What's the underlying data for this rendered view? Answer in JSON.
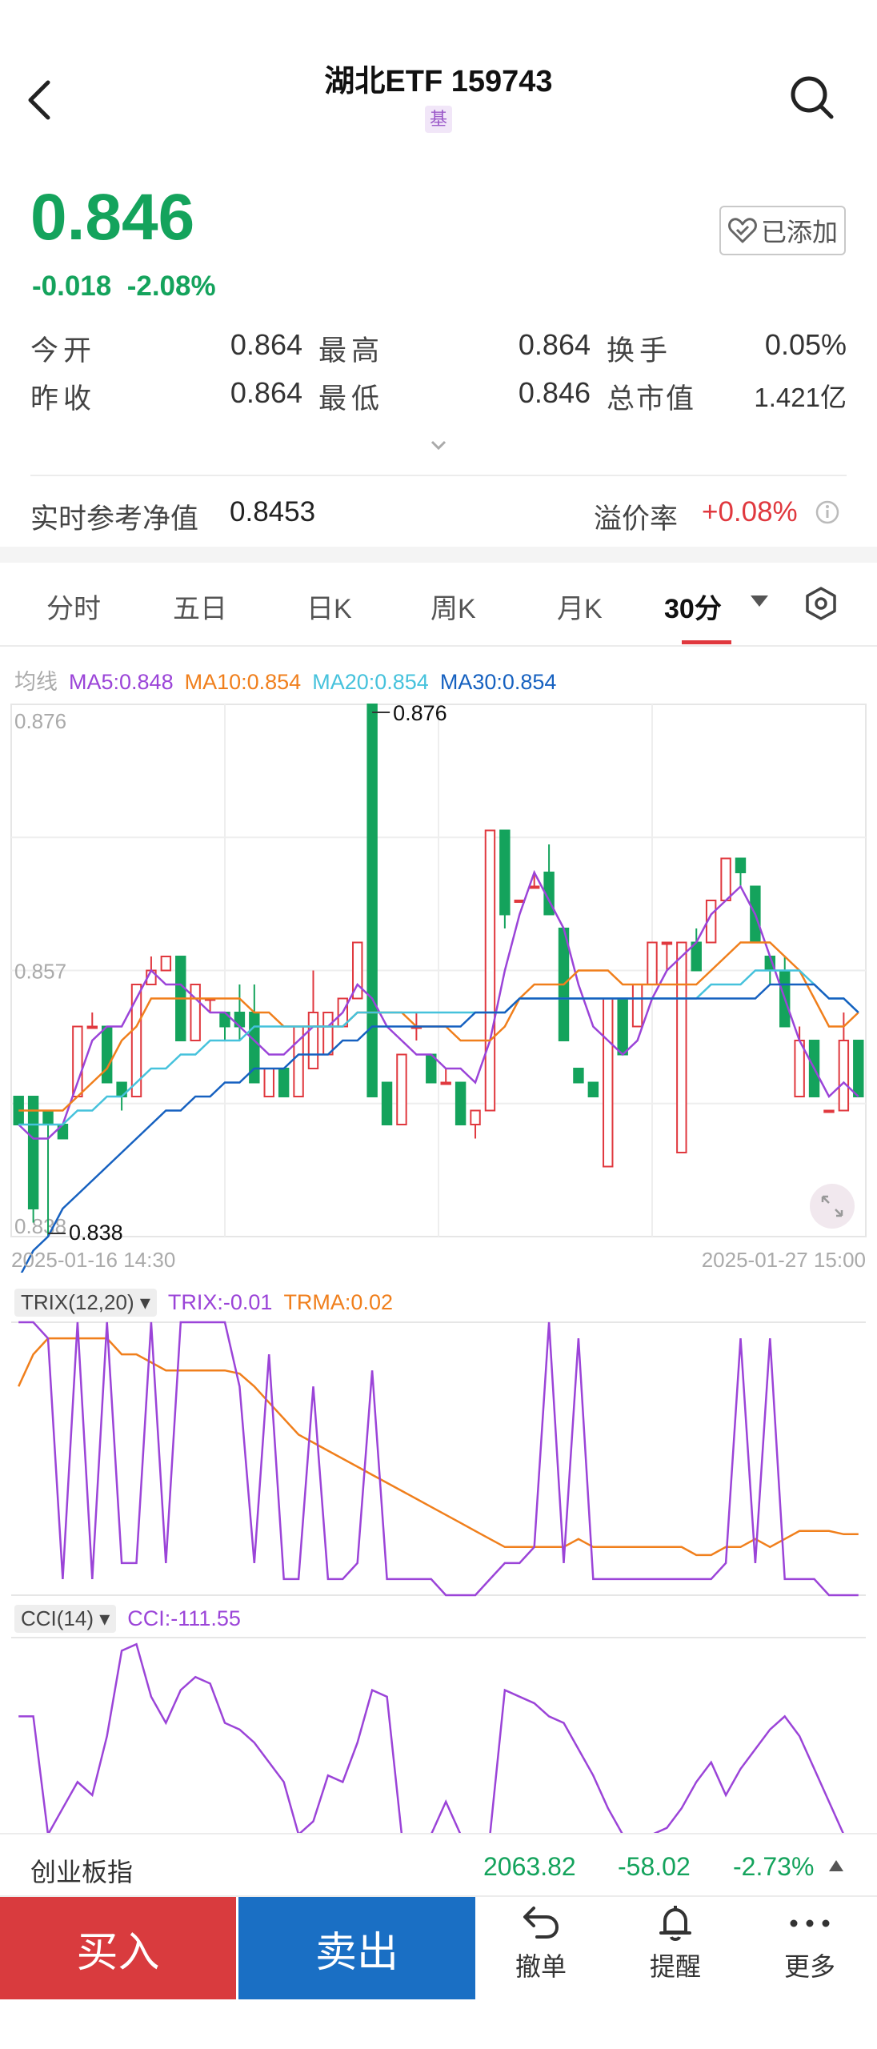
{
  "header": {
    "title": "湖北ETF 159743",
    "badge": "基"
  },
  "quote": {
    "price": "0.846",
    "change": "-0.018",
    "change_pct": "-2.08%",
    "added_label": "已添加"
  },
  "stats": [
    {
      "label": "今开",
      "value": "0.864",
      "color": "#333333"
    },
    {
      "label": "最高",
      "value": "0.864",
      "color": "#333333"
    },
    {
      "label": "换手",
      "value": "0.05%",
      "color": "#333333"
    },
    {
      "label": "昨收",
      "value": "0.864",
      "color": "#333333"
    },
    {
      "label": "最低",
      "value": "0.846",
      "color": "#14a35c"
    },
    {
      "label": "总市值",
      "value": "1.421亿",
      "color": "#333333"
    }
  ],
  "nav": {
    "label": "实时参考净值",
    "value": "0.8453",
    "premium_label": "溢价率",
    "premium_value": "+0.08%"
  },
  "tabs": [
    "分时",
    "五日",
    "日K",
    "周K",
    "月K",
    "30分"
  ],
  "active_tab": "30分",
  "legend": {
    "title": "均线",
    "ma5": "MA5:0.848",
    "ma10": "MA10:0.854",
    "ma20": "MA20:0.854",
    "ma30": "MA30:0.854"
  },
  "colors": {
    "up": "#e0383e",
    "down": "#14a35c",
    "ma5": "#9b44d8",
    "ma10": "#f07f1c",
    "ma20": "#46c2dc",
    "ma30": "#1661c0",
    "trix": "#9b44d8",
    "trma": "#f07f1c",
    "cci": "#9b44d8"
  },
  "chart_data": [
    {
      "type": "candlestick",
      "y_ticks": [
        "0.876",
        "0.857",
        "0.838"
      ],
      "ylim": [
        0.838,
        0.876
      ],
      "max_label": "0.876",
      "min_label": "0.838",
      "x_start": "2025-01-16 14:30",
      "x_end": "2025-01-27 15:00",
      "candles": [
        {
          "o": 0.848,
          "c": 0.846,
          "h": 0.848,
          "l": 0.846
        },
        {
          "o": 0.848,
          "c": 0.84,
          "h": 0.848,
          "l": 0.839
        },
        {
          "o": 0.847,
          "c": 0.846,
          "h": 0.847,
          "l": 0.838
        },
        {
          "o": 0.846,
          "c": 0.845,
          "h": 0.846,
          "l": 0.845
        },
        {
          "o": 0.848,
          "c": 0.853,
          "h": 0.853,
          "l": 0.848
        },
        {
          "o": 0.853,
          "c": 0.853,
          "h": 0.854,
          "l": 0.853
        },
        {
          "o": 0.853,
          "c": 0.849,
          "h": 0.853,
          "l": 0.849
        },
        {
          "o": 0.849,
          "c": 0.848,
          "h": 0.849,
          "l": 0.847
        },
        {
          "o": 0.848,
          "c": 0.856,
          "h": 0.856,
          "l": 0.848
        },
        {
          "o": 0.856,
          "c": 0.857,
          "h": 0.858,
          "l": 0.856
        },
        {
          "o": 0.857,
          "c": 0.858,
          "h": 0.858,
          "l": 0.857
        },
        {
          "o": 0.858,
          "c": 0.852,
          "h": 0.858,
          "l": 0.852
        },
        {
          "o": 0.852,
          "c": 0.856,
          "h": 0.856,
          "l": 0.852
        },
        {
          "o": 0.855,
          "c": 0.855,
          "h": 0.855,
          "l": 0.854
        },
        {
          "o": 0.854,
          "c": 0.853,
          "h": 0.854,
          "l": 0.852
        },
        {
          "o": 0.854,
          "c": 0.853,
          "h": 0.856,
          "l": 0.852
        },
        {
          "o": 0.854,
          "c": 0.849,
          "h": 0.856,
          "l": 0.849
        },
        {
          "o": 0.848,
          "c": 0.85,
          "h": 0.85,
          "l": 0.848
        },
        {
          "o": 0.85,
          "c": 0.848,
          "h": 0.85,
          "l": 0.848
        },
        {
          "o": 0.848,
          "c": 0.853,
          "h": 0.853,
          "l": 0.848
        },
        {
          "o": 0.85,
          "c": 0.854,
          "h": 0.857,
          "l": 0.85
        },
        {
          "o": 0.851,
          "c": 0.854,
          "h": 0.854,
          "l": 0.851
        },
        {
          "o": 0.853,
          "c": 0.855,
          "h": 0.855,
          "l": 0.853
        },
        {
          "o": 0.855,
          "c": 0.859,
          "h": 0.859,
          "l": 0.855
        },
        {
          "o": 0.876,
          "c": 0.848,
          "h": 0.876,
          "l": 0.848
        },
        {
          "o": 0.849,
          "c": 0.846,
          "h": 0.849,
          "l": 0.846
        },
        {
          "o": 0.846,
          "c": 0.851,
          "h": 0.851,
          "l": 0.846
        },
        {
          "o": 0.853,
          "c": 0.853,
          "h": 0.854,
          "l": 0.852
        },
        {
          "o": 0.851,
          "c": 0.849,
          "h": 0.851,
          "l": 0.849
        },
        {
          "o": 0.849,
          "c": 0.849,
          "h": 0.85,
          "l": 0.849
        },
        {
          "o": 0.849,
          "c": 0.846,
          "h": 0.849,
          "l": 0.846
        },
        {
          "o": 0.846,
          "c": 0.847,
          "h": 0.847,
          "l": 0.845
        },
        {
          "o": 0.847,
          "c": 0.867,
          "h": 0.867,
          "l": 0.847
        },
        {
          "o": 0.867,
          "c": 0.861,
          "h": 0.867,
          "l": 0.86
        },
        {
          "o": 0.862,
          "c": 0.862,
          "h": 0.862,
          "l": 0.862
        },
        {
          "o": 0.863,
          "c": 0.863,
          "h": 0.864,
          "l": 0.863
        },
        {
          "o": 0.864,
          "c": 0.861,
          "h": 0.866,
          "l": 0.861
        },
        {
          "o": 0.86,
          "c": 0.852,
          "h": 0.86,
          "l": 0.852
        },
        {
          "o": 0.85,
          "c": 0.849,
          "h": 0.85,
          "l": 0.849
        },
        {
          "o": 0.849,
          "c": 0.848,
          "h": 0.849,
          "l": 0.848
        },
        {
          "o": 0.843,
          "c": 0.855,
          "h": 0.855,
          "l": 0.843
        },
        {
          "o": 0.855,
          "c": 0.851,
          "h": 0.855,
          "l": 0.851
        },
        {
          "o": 0.853,
          "c": 0.856,
          "h": 0.856,
          "l": 0.853
        },
        {
          "o": 0.856,
          "c": 0.859,
          "h": 0.859,
          "l": 0.856
        },
        {
          "o": 0.859,
          "c": 0.859,
          "h": 0.859,
          "l": 0.857
        },
        {
          "o": 0.844,
          "c": 0.859,
          "h": 0.859,
          "l": 0.844
        },
        {
          "o": 0.859,
          "c": 0.857,
          "h": 0.86,
          "l": 0.857
        },
        {
          "o": 0.859,
          "c": 0.862,
          "h": 0.862,
          "l": 0.859
        },
        {
          "o": 0.862,
          "c": 0.865,
          "h": 0.865,
          "l": 0.862
        },
        {
          "o": 0.865,
          "c": 0.864,
          "h": 0.865,
          "l": 0.863
        },
        {
          "o": 0.863,
          "c": 0.859,
          "h": 0.863,
          "l": 0.859
        },
        {
          "o": 0.858,
          "c": 0.857,
          "h": 0.858,
          "l": 0.856
        },
        {
          "o": 0.857,
          "c": 0.853,
          "h": 0.858,
          "l": 0.853
        },
        {
          "o": 0.848,
          "c": 0.852,
          "h": 0.853,
          "l": 0.848
        },
        {
          "o": 0.852,
          "c": 0.848,
          "h": 0.852,
          "l": 0.848
        },
        {
          "o": 0.847,
          "c": 0.847,
          "h": 0.847,
          "l": 0.847
        },
        {
          "o": 0.847,
          "c": 0.852,
          "h": 0.854,
          "l": 0.847
        },
        {
          "o": 0.852,
          "c": 0.848,
          "h": 0.852,
          "l": 0.848
        }
      ],
      "ma5": [
        0.846,
        0.845,
        0.845,
        0.846,
        0.849,
        0.852,
        0.853,
        0.853,
        0.855,
        0.857,
        0.856,
        0.856,
        0.855,
        0.854,
        0.854,
        0.853,
        0.852,
        0.851,
        0.851,
        0.852,
        0.853,
        0.853,
        0.854,
        0.856,
        0.855,
        0.853,
        0.852,
        0.851,
        0.851,
        0.85,
        0.85,
        0.849,
        0.852,
        0.857,
        0.861,
        0.864,
        0.862,
        0.86,
        0.856,
        0.853,
        0.852,
        0.851,
        0.852,
        0.855,
        0.857,
        0.858,
        0.859,
        0.861,
        0.862,
        0.863,
        0.861,
        0.858,
        0.855,
        0.852,
        0.85,
        0.848,
        0.849,
        0.848
      ],
      "ma10": [
        0.847,
        0.847,
        0.847,
        0.847,
        0.848,
        0.849,
        0.85,
        0.852,
        0.853,
        0.855,
        0.855,
        0.855,
        0.855,
        0.855,
        0.855,
        0.855,
        0.854,
        0.854,
        0.853,
        0.853,
        0.853,
        0.853,
        0.853,
        0.854,
        0.854,
        0.854,
        0.854,
        0.853,
        0.853,
        0.853,
        0.852,
        0.852,
        0.852,
        0.853,
        0.855,
        0.856,
        0.856,
        0.856,
        0.857,
        0.857,
        0.857,
        0.856,
        0.856,
        0.856,
        0.856,
        0.856,
        0.856,
        0.857,
        0.858,
        0.859,
        0.859,
        0.859,
        0.858,
        0.857,
        0.855,
        0.853,
        0.853,
        0.854
      ],
      "ma20": [
        0.846,
        0.846,
        0.846,
        0.846,
        0.847,
        0.847,
        0.848,
        0.848,
        0.849,
        0.85,
        0.85,
        0.851,
        0.851,
        0.852,
        0.852,
        0.852,
        0.853,
        0.853,
        0.853,
        0.853,
        0.853,
        0.853,
        0.853,
        0.854,
        0.854,
        0.854,
        0.854,
        0.854,
        0.854,
        0.854,
        0.854,
        0.854,
        0.854,
        0.854,
        0.855,
        0.855,
        0.855,
        0.855,
        0.855,
        0.855,
        0.855,
        0.855,
        0.855,
        0.855,
        0.855,
        0.855,
        0.855,
        0.856,
        0.856,
        0.856,
        0.857,
        0.857,
        0.857,
        0.857,
        0.856,
        0.855,
        0.855,
        0.854
      ],
      "ma30": [
        0.835,
        0.837,
        0.838,
        0.84,
        0.841,
        0.842,
        0.843,
        0.844,
        0.845,
        0.846,
        0.847,
        0.847,
        0.848,
        0.848,
        0.849,
        0.849,
        0.85,
        0.85,
        0.85,
        0.851,
        0.851,
        0.851,
        0.852,
        0.852,
        0.853,
        0.853,
        0.853,
        0.853,
        0.853,
        0.853,
        0.853,
        0.854,
        0.854,
        0.854,
        0.855,
        0.855,
        0.855,
        0.855,
        0.855,
        0.855,
        0.855,
        0.855,
        0.855,
        0.855,
        0.855,
        0.855,
        0.855,
        0.855,
        0.855,
        0.855,
        0.855,
        0.856,
        0.856,
        0.856,
        0.856,
        0.855,
        0.855,
        0.854
      ]
    },
    {
      "type": "line",
      "selector": "TRIX(12,20)",
      "trix_label": "TRIX:-0.01",
      "trma_label": "TRMA:0.02",
      "ylim": [
        -0.05,
        0.12
      ],
      "trix": [
        0.12,
        0.12,
        0.11,
        -0.04,
        0.12,
        -0.04,
        0.12,
        -0.03,
        -0.03,
        0.12,
        -0.03,
        0.12,
        0.12,
        0.12,
        0.12,
        0.08,
        -0.03,
        0.1,
        -0.04,
        -0.04,
        0.08,
        -0.04,
        -0.04,
        -0.03,
        0.09,
        -0.04,
        -0.04,
        -0.04,
        -0.04,
        -0.05,
        -0.05,
        -0.05,
        -0.04,
        -0.03,
        -0.03,
        -0.02,
        0.12,
        -0.03,
        0.11,
        -0.04,
        -0.04,
        -0.04,
        -0.04,
        -0.04,
        -0.04,
        -0.04,
        -0.04,
        -0.04,
        -0.03,
        0.11,
        -0.03,
        0.11,
        -0.04,
        -0.04,
        -0.04,
        -0.05,
        -0.05,
        -0.05
      ],
      "trma": [
        0.08,
        0.1,
        0.11,
        0.11,
        0.11,
        0.11,
        0.11,
        0.1,
        0.1,
        0.095,
        0.09,
        0.09,
        0.09,
        0.09,
        0.09,
        0.088,
        0.08,
        0.07,
        0.06,
        0.05,
        0.045,
        0.04,
        0.035,
        0.03,
        0.025,
        0.02,
        0.015,
        0.01,
        0.005,
        0.0,
        -0.005,
        -0.01,
        -0.015,
        -0.02,
        -0.02,
        -0.02,
        -0.02,
        -0.02,
        -0.015,
        -0.02,
        -0.02,
        -0.02,
        -0.02,
        -0.02,
        -0.02,
        -0.02,
        -0.025,
        -0.025,
        -0.02,
        -0.02,
        -0.015,
        -0.02,
        -0.015,
        -0.01,
        -0.01,
        -0.01,
        -0.012,
        -0.012
      ]
    },
    {
      "type": "line",
      "selector": "CCI(14)",
      "cci_label": "CCI:-111.55",
      "ylim": [
        -120,
        180
      ],
      "cci": [
        60,
        60,
        -120,
        -80,
        -40,
        -60,
        30,
        160,
        170,
        90,
        50,
        100,
        120,
        110,
        50,
        40,
        20,
        -10,
        -40,
        -120,
        -100,
        -30,
        -40,
        20,
        100,
        90,
        -120,
        -120,
        -120,
        -70,
        -120,
        -120,
        -120,
        100,
        90,
        80,
        60,
        50,
        10,
        -30,
        -80,
        -120,
        -120,
        -120,
        -110,
        -80,
        -40,
        -10,
        -60,
        -20,
        10,
        40,
        60,
        30,
        -20,
        -70,
        -120,
        -120
      ]
    }
  ],
  "index_ticker": {
    "name": "创业板指",
    "value": "2063.82",
    "change": "-58.02",
    "change_pct": "-2.73%"
  },
  "bottom": {
    "buy": "买入",
    "sell": "卖出",
    "cancel": "撤单",
    "alert": "提醒",
    "more": "更多"
  }
}
